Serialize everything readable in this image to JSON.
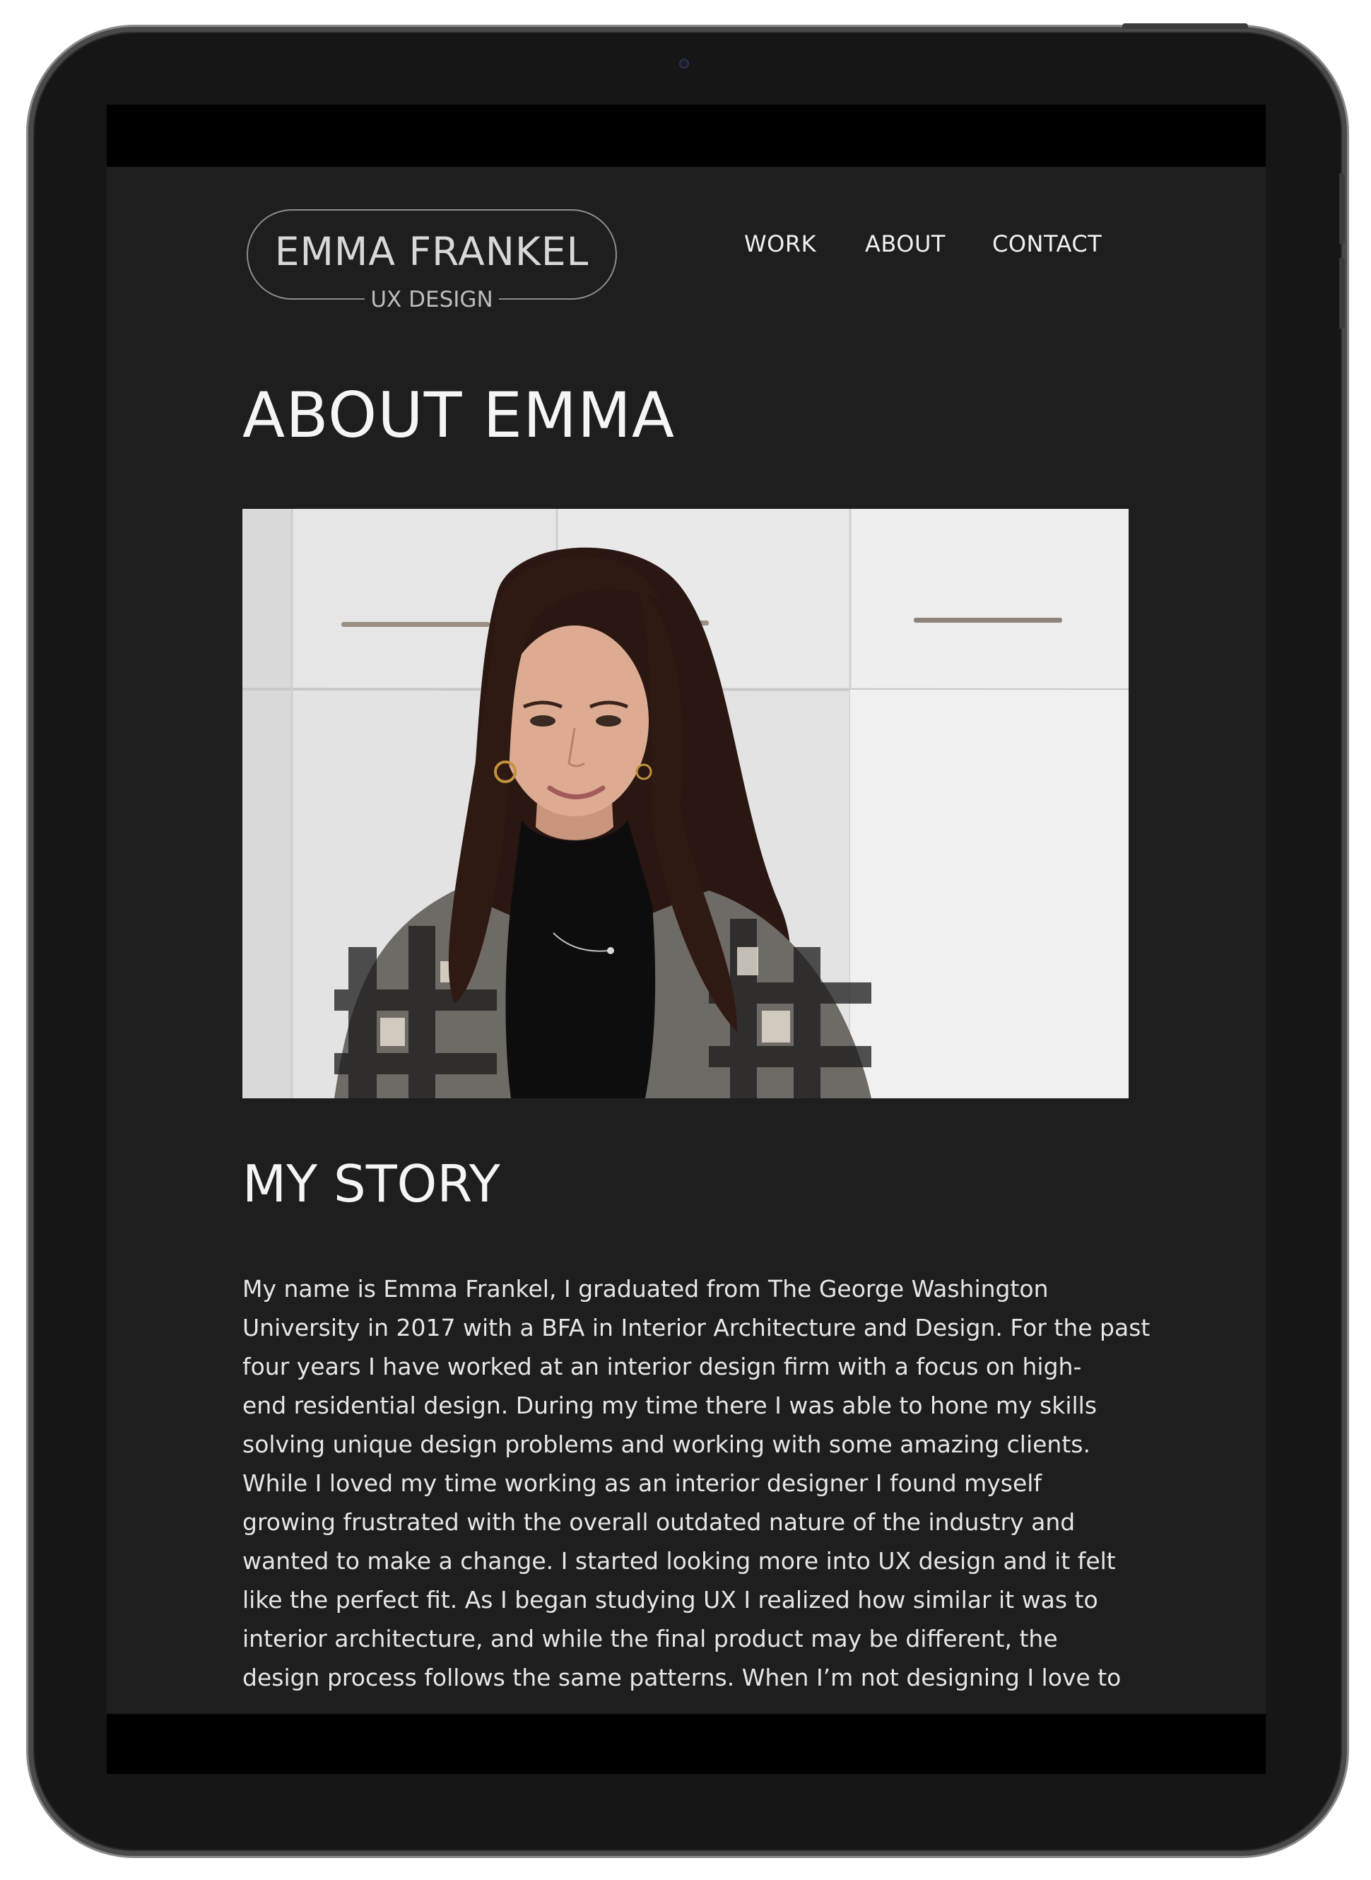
{
  "logo": {
    "name": "EMMA FRANKEL",
    "subtitle": "UX DESIGN"
  },
  "nav": {
    "work": "WORK",
    "about": "ABOUT",
    "contact": "CONTACT"
  },
  "about": {
    "heading": "ABOUT EMMA",
    "photo": "portrait-photo"
  },
  "story": {
    "heading": "MY STORY",
    "lines": [
      "My name is Emma Frankel, I graduated from The George Washington",
      "University in 2017 with a BFA in Interior Architecture and Design. For the past",
      "four years I have worked at an interior design firm with a focus on high-",
      "end residential design. During my time there I was able to hone my skills",
      "solving unique design problems and working with some amazing clients.",
      "While I loved my time working as an interior designer I found myself",
      "growing frustrated with the overall outdated nature of the industry and",
      "wanted to make a change. I started looking more into UX design and it felt",
      "like the perfect fit. As I began studying UX I realized how similar it was to",
      "interior architecture, and while the final product may be different, the",
      "design process follows the same patterns. When I’m not designing I love to"
    ]
  },
  "colors": {
    "page_background": "#1e1e1e",
    "device_bezel": "#161616",
    "text": "#f2f2f2"
  }
}
